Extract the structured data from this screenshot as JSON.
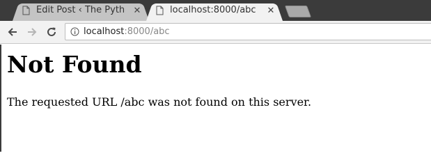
{
  "browser": {
    "tabs": [
      {
        "title": "Edit Post ‹ The Pyth",
        "active": false
      },
      {
        "title": "localhost:8000/abc",
        "active": true
      }
    ],
    "url": {
      "host": "localhost",
      "rest": ":8000/abc"
    },
    "close_glyph": "✕"
  },
  "page": {
    "heading": "Not Found",
    "message": "The requested URL /abc was not found on this server."
  },
  "colors": {
    "tabstrip": "#3b3b3b",
    "active_tab": "#f2f2f2",
    "inactive_tab": "#c4c4c4"
  }
}
